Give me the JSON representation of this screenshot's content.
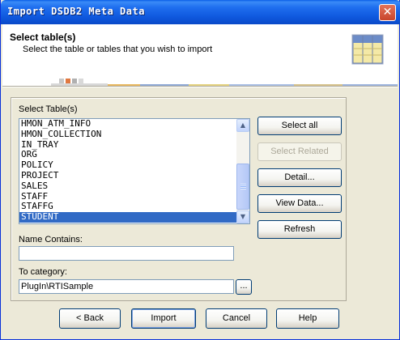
{
  "window": {
    "title": "Import DSDB2 Meta Data",
    "close_glyph": "✕"
  },
  "header": {
    "title": "Select table(s)",
    "subtitle": "Select the table or tables that you wish to import",
    "icon": "table-grid-icon"
  },
  "tables": {
    "label": "Select Table(s)",
    "items": [
      "HMON_ATM_INFO",
      "HMON_COLLECTION",
      "IN_TRAY",
      "ORG",
      "POLICY",
      "PROJECT",
      "SALES",
      "STAFF",
      "STAFFG",
      "STUDENT"
    ],
    "selected": "STUDENT"
  },
  "name_contains": {
    "label": "Name Contains:",
    "value": ""
  },
  "category": {
    "label": "To category:",
    "value": "PlugIn\\RTISample",
    "browse_label": "..."
  },
  "side_buttons": {
    "select_all": "Select all",
    "select_related": "Select Related",
    "detail": "Detail...",
    "view_data": "View Data...",
    "refresh": "Refresh"
  },
  "footer_buttons": {
    "back": "< Back",
    "import": "Import",
    "cancel": "Cancel",
    "help": "Help"
  },
  "colors": {
    "titlebar": "#0A5FE8",
    "selection": "#316AC5",
    "dialog": "#ECE9D8"
  }
}
